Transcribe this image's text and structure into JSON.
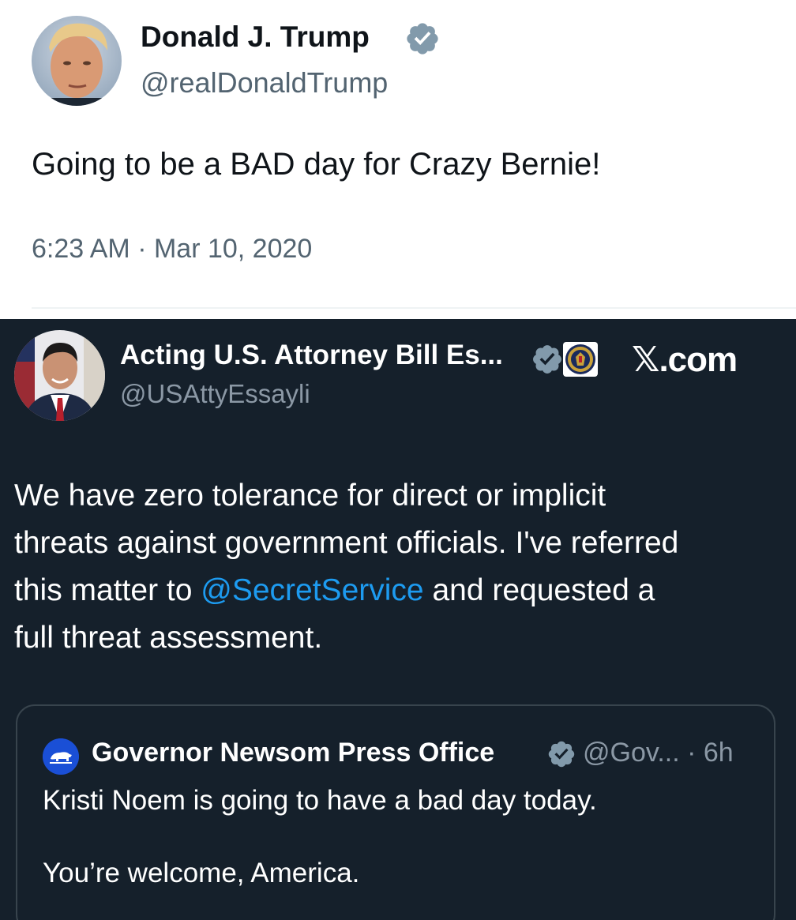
{
  "top_tweet": {
    "author_name": "Donald J. Trump",
    "author_handle": "@realDonaldTrump",
    "text": "Going to be a BAD day for Crazy Bernie!",
    "timestamp": "6:23 AM · Mar 10, 2020",
    "verified_badge": "verified-badge-icon",
    "theme": "light"
  },
  "main_tweet": {
    "author_name": "Acting U.S. Attorney Bill Es...",
    "author_handle": "@USAttyEssayli",
    "verified_badge": "verified-badge-icon",
    "affiliation_badge": "doj-seal-icon",
    "source_watermark": "X.com",
    "text_lines": {
      "line1": "We have zero tolerance for direct or implicit",
      "line2": "threats against government officials. I've referred",
      "line3_before": "this matter to ",
      "line3_mention": "@SecretService",
      "line3_after": " and requested a",
      "line4": "full threat assessment."
    },
    "theme": "dark"
  },
  "quoted_tweet": {
    "author_name": "Governor Newsom Press Office",
    "author_handle_time": "@Gov... · 6h",
    "avatar_icon": "california-bear-icon",
    "text_line1": "Kristi Noem is going to have a bad day today.",
    "text_line2": "You’re welcome, America."
  },
  "colors": {
    "dark_background": "#15202b",
    "mention_blue": "#1d9bf0",
    "verified_gray": "#829aab",
    "secondary_text_light": "#536471",
    "secondary_text_dark": "#8b98a5"
  }
}
